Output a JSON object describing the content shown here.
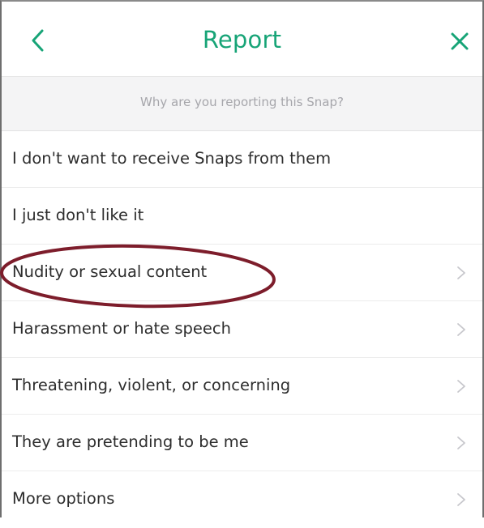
{
  "header": {
    "title": "Report",
    "back_icon": "chevron-left-icon",
    "close_icon": "close-icon"
  },
  "subheader": {
    "prompt": "Why are you reporting this Snap?"
  },
  "options": [
    {
      "label": "I don't want to receive Snaps from them",
      "has_chevron": false
    },
    {
      "label": "I just don't like it",
      "has_chevron": false
    },
    {
      "label": "Nudity or sexual content",
      "has_chevron": true,
      "circled": true
    },
    {
      "label": "Harassment or hate speech",
      "has_chevron": true
    },
    {
      "label": "Threatening, violent, or concerning",
      "has_chevron": true
    },
    {
      "label": "They are pretending to be me",
      "has_chevron": true
    },
    {
      "label": "More options",
      "has_chevron": true
    }
  ],
  "colors": {
    "accent": "#17a477",
    "annotation": "#7d1d2b",
    "subheader_bg": "#f4f4f5",
    "text": "#2d2d2d",
    "chevron": "#c7c7cc"
  }
}
